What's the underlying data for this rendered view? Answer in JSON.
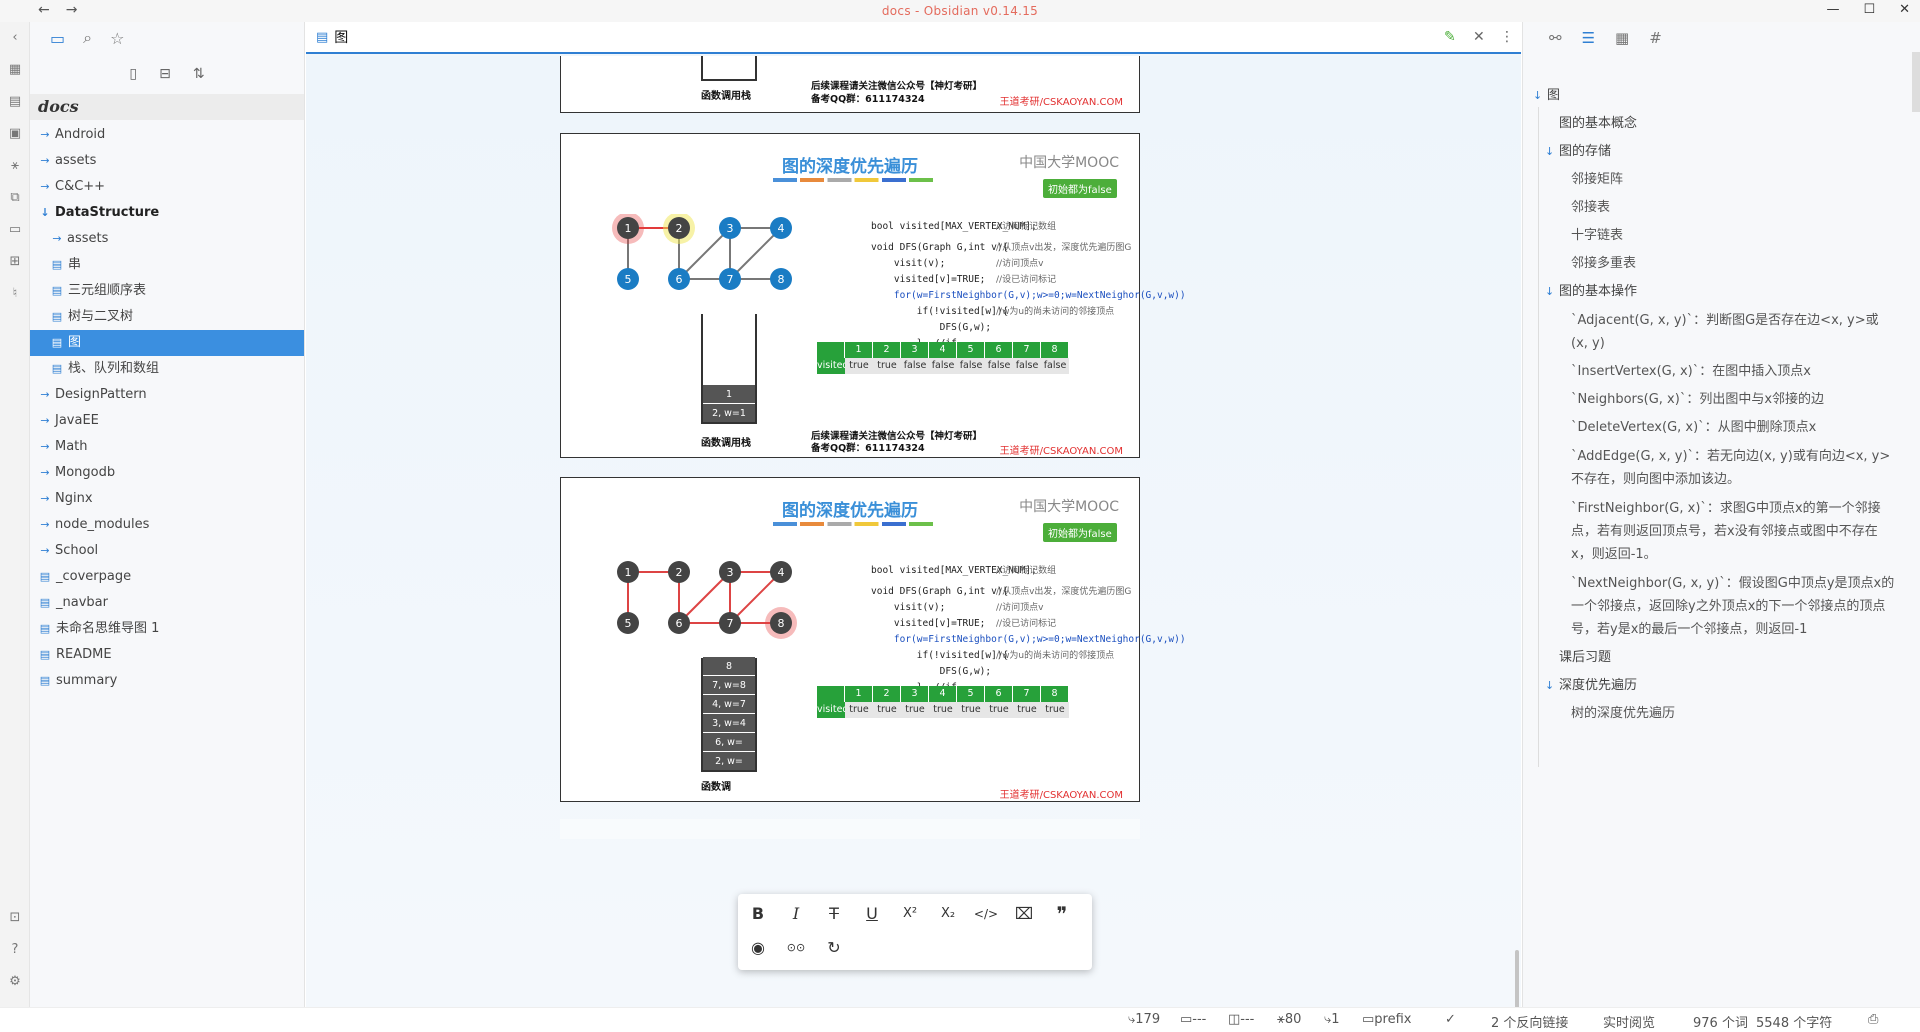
{
  "window": {
    "title": "docs - Obsidian v0.14.15",
    "back": "←",
    "forward": "→",
    "minimize": "—",
    "maximize": "☐",
    "close": "✕"
  },
  "left_pane": {
    "vault_name": "docs",
    "tree": [
      {
        "label": "Android",
        "type": "folder",
        "depth": 0,
        "expanded": false
      },
      {
        "label": "assets",
        "type": "folder",
        "depth": 0,
        "expanded": false
      },
      {
        "label": "C&C++",
        "type": "folder",
        "depth": 0,
        "expanded": false
      },
      {
        "label": "DataStructure",
        "type": "folder",
        "depth": 0,
        "expanded": true
      },
      {
        "label": "assets",
        "type": "folder",
        "depth": 1,
        "expanded": false
      },
      {
        "label": "串",
        "type": "file",
        "depth": 1
      },
      {
        "label": "三元组顺序表",
        "type": "file",
        "depth": 1
      },
      {
        "label": "树与二叉树",
        "type": "file",
        "depth": 1
      },
      {
        "label": "图",
        "type": "file",
        "depth": 1,
        "selected": true
      },
      {
        "label": "栈、队列和数组",
        "type": "file",
        "depth": 1
      },
      {
        "label": "DesignPattern",
        "type": "folder",
        "depth": 0,
        "expanded": false
      },
      {
        "label": "JavaEE",
        "type": "folder",
        "depth": 0,
        "expanded": false
      },
      {
        "label": "Math",
        "type": "folder",
        "depth": 0,
        "expanded": false
      },
      {
        "label": "Mongodb",
        "type": "folder",
        "depth": 0,
        "expanded": false
      },
      {
        "label": "Nginx",
        "type": "folder",
        "depth": 0,
        "expanded": false
      },
      {
        "label": "node_modules",
        "type": "folder",
        "depth": 0,
        "expanded": false
      },
      {
        "label": "School",
        "type": "folder",
        "depth": 0,
        "expanded": false
      },
      {
        "label": "_coverpage",
        "type": "file",
        "depth": 0
      },
      {
        "label": "_navbar",
        "type": "file",
        "depth": 0
      },
      {
        "label": "未命名思维导图 1",
        "type": "file",
        "depth": 0
      },
      {
        "label": "README",
        "type": "file",
        "depth": 0
      },
      {
        "label": "summary",
        "type": "file",
        "depth": 0
      }
    ]
  },
  "editor": {
    "tab_title": "图",
    "slide_top": {
      "stack_label": "函数调用栈",
      "footer_left_1": "后续课程请关注微信公众号【神灯考研】",
      "footer_left_2": "备考QQ群：611174324",
      "footer_right": "王道考研/CSKAOYAN.COM"
    },
    "slide1": {
      "title": "图的深度优先遍历",
      "logo": "中国大学MOOC",
      "pill": "初始都为false",
      "code_line_1": "bool visited[MAX_VERTEX_NUM];",
      "code_comment_1": "//访问标记数组",
      "code_line_2": "void DFS(Graph G,int v){",
      "code_comment_2": "//从顶点v出发，深度优先遍历图G",
      "code_line_3": "    visit(v);",
      "code_comment_3": "//访问顶点v",
      "code_line_4": "    visited[v]=TRUE;",
      "code_comment_4": "//设已访问标记",
      "code_line_5": "    for(w=FirstNeighbor(G,v);w>=0;w=NextNeighor(G,v,w))",
      "code_line_6": "        if(!visited[w]){",
      "code_comment_6": "//w为u的尚未访问的邻接顶点",
      "code_line_7": "            DFS(G,w);",
      "code_line_8": "        }  //if",
      "code_line_9": "}",
      "visited_header": [
        "1",
        "2",
        "3",
        "4",
        "5",
        "6",
        "7",
        "8"
      ],
      "visited_label": "visited",
      "visited_values": [
        "true",
        "true",
        "false",
        "false",
        "false",
        "false",
        "false",
        "false"
      ],
      "stack": [
        "1",
        "2, w=1"
      ],
      "nodes": [
        "1",
        "2",
        "3",
        "4",
        "5",
        "6",
        "7",
        "8"
      ],
      "stack_label": "函数调用栈",
      "footer_left_1": "后续课程请关注微信公众号【神灯考研】",
      "footer_left_2": "备考QQ群：611174324",
      "footer_right": "王道考研/CSKAOYAN.COM"
    },
    "slide2": {
      "title": "图的深度优先遍历",
      "logo": "中国大学MOOC",
      "pill": "初始都为false",
      "visited_values": [
        "true",
        "true",
        "true",
        "true",
        "true",
        "true",
        "true",
        "true"
      ],
      "stack": [
        "8",
        "7, w=8",
        "4, w=7",
        "3, w=4",
        "6, w=",
        "2, w="
      ],
      "stack_label": "函数调",
      "footer_right": "王道考研/CSKAOYAN.COM"
    }
  },
  "format_toolbar": {
    "bold": "B",
    "italic": "I",
    "strike": "T",
    "underline": "U",
    "superscript": "X²",
    "subscript": "X₂",
    "code": "</>",
    "codeblock": "⌧",
    "quote": "❞",
    "preview": "◉",
    "reading": "⊙⊙",
    "redo": "↻"
  },
  "outline": {
    "items": [
      {
        "label": "图",
        "level": 1,
        "arrow": true
      },
      {
        "label": "图的基本概念",
        "level": 2
      },
      {
        "label": "图的存储",
        "level": 2,
        "arrow": true
      },
      {
        "label": "邻接矩阵",
        "level": 3
      },
      {
        "label": "邻接表",
        "level": 3
      },
      {
        "label": "十字链表",
        "level": 3
      },
      {
        "label": "邻接多重表",
        "level": 3
      },
      {
        "label": "图的基本操作",
        "level": 2,
        "arrow": true
      },
      {
        "label": "`Adjacent(G, x, y)`：判断图G是否存在边<x, y>或(x, y)",
        "level": 3,
        "multi": true
      },
      {
        "label": "`InsertVertex(G, x)`：在图中插入顶点x",
        "level": 3
      },
      {
        "label": "`Neighbors(G, x)`：列出图中与x邻接的边",
        "level": 3
      },
      {
        "label": "`DeleteVertex(G, x)`：从图中删除顶点x",
        "level": 3
      },
      {
        "label": "`AddEdge(G, x, y)`：若无向边(x, y)或有向边<x, y>不存在，则向图中添加该边。",
        "level": 3,
        "multi": true
      },
      {
        "label": "`FirstNeighbor(G, x)`：求图G中顶点x的第一个邻接点，若有则返回顶点号，若x没有邻接点或图中不存在x，则返回-1。",
        "level": 3,
        "multi": true
      },
      {
        "label": "`NextNeighbor(G, x, y)`：假设图G中顶点y是顶点x的一个邻接点，返回除y之外顶点x的下一个邻接点的顶点号，若y是x的最后一个邻接点，则返回-1",
        "level": 3,
        "multi": true
      },
      {
        "label": "课后习题",
        "level": 2
      },
      {
        "label": "深度优先遍历",
        "level": 2,
        "arrow": true
      },
      {
        "label": "树的深度优先遍历",
        "level": 3
      }
    ]
  },
  "status_bar": {
    "backlinks_count": "179",
    "s2": "---",
    "s3": "---",
    "s4": "80",
    "s5": "1",
    "prefix": "prefix",
    "check": "✓",
    "links": "2 个反向链接",
    "mode": "实时阅览",
    "words": "976 个词",
    "chars": "5548 个字符"
  }
}
